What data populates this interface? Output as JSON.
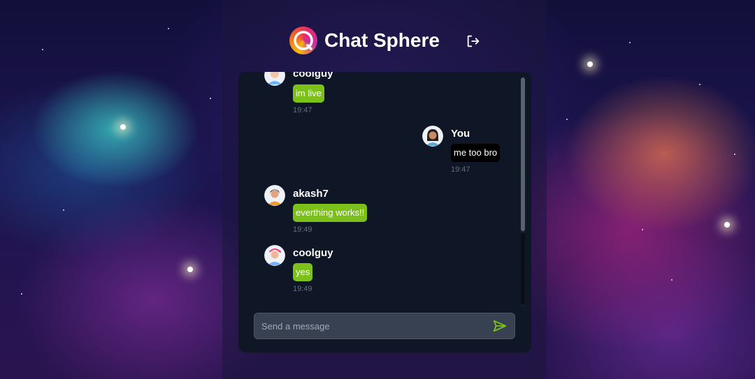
{
  "app": {
    "title": "Chat Sphere",
    "accent_color": "#7bc11a"
  },
  "header": {
    "logo_icon": "chat-bubble-logo-icon",
    "logout_icon": "logout-icon"
  },
  "messages": [
    {
      "user": "coolguy",
      "text": "im live",
      "time": "19:47",
      "own": false,
      "avatar": "avatar-pink-cap"
    },
    {
      "user": "You",
      "text": "me too bro",
      "time": "19:47",
      "own": true,
      "avatar": "avatar-dark-hair"
    },
    {
      "user": "akash7",
      "text": "everthing works!!",
      "time": "19:49",
      "own": false,
      "avatar": "avatar-orange-shirt"
    },
    {
      "user": "coolguy",
      "text": "yes",
      "time": "19:49",
      "own": false,
      "avatar": "avatar-pink-cap"
    }
  ],
  "composer": {
    "placeholder": "Send a message",
    "value": "",
    "send_icon": "send-icon"
  }
}
